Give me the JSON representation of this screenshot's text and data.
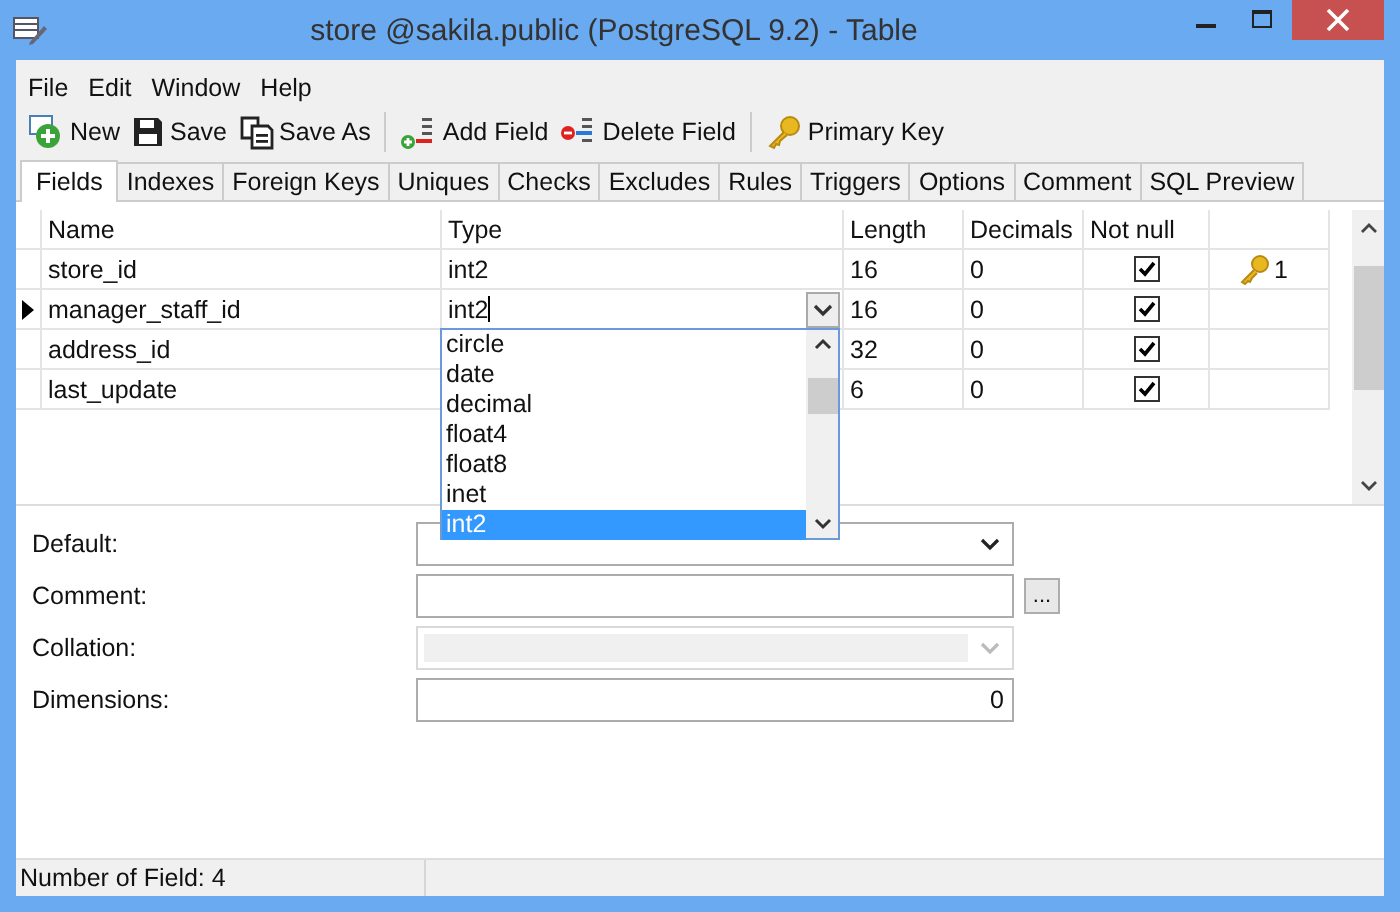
{
  "window": {
    "title": "store @sakila.public (PostgreSQL 9.2) - Table"
  },
  "menu": [
    "File",
    "Edit",
    "Window",
    "Help"
  ],
  "toolbar": [
    {
      "kind": "new",
      "label": "New"
    },
    {
      "kind": "save",
      "label": "Save"
    },
    {
      "kind": "saveas",
      "label": "Save As"
    },
    {
      "kind": "separator"
    },
    {
      "kind": "addfield",
      "label": "Add Field"
    },
    {
      "kind": "deletefield",
      "label": "Delete Field"
    },
    {
      "kind": "separator"
    },
    {
      "kind": "primarykey",
      "label": "Primary Key"
    }
  ],
  "tabs": [
    {
      "label": "Fields",
      "selected": true
    },
    {
      "label": "Indexes",
      "selected": false
    },
    {
      "label": "Foreign Keys",
      "selected": false
    },
    {
      "label": "Uniques",
      "selected": false
    },
    {
      "label": "Checks",
      "selected": false
    },
    {
      "label": "Excludes",
      "selected": false
    },
    {
      "label": "Rules",
      "selected": false
    },
    {
      "label": "Triggers",
      "selected": false
    },
    {
      "label": "Options",
      "selected": false
    },
    {
      "label": "Comment",
      "selected": false
    },
    {
      "label": "SQL Preview",
      "selected": false
    }
  ],
  "grid": {
    "columns": [
      "Name",
      "Type",
      "Length",
      "Decimals",
      "Not null"
    ],
    "rows": [
      {
        "name": "store_id",
        "type": "int2",
        "length": "16",
        "decimals": "0",
        "not_null": true,
        "primary_key": "1",
        "current": false
      },
      {
        "name": "manager_staff_id",
        "type": "int2",
        "length": "16",
        "decimals": "0",
        "not_null": true,
        "current": true
      },
      {
        "name": "address_id",
        "length": "32",
        "decimals": "0",
        "not_null": true,
        "current": false
      },
      {
        "name": "last_update",
        "length": "6",
        "decimals": "0",
        "not_null": true,
        "current": false
      }
    ]
  },
  "type_dropdown": {
    "items": [
      {
        "label": "circle",
        "selected": false
      },
      {
        "label": "date",
        "selected": false
      },
      {
        "label": "decimal",
        "selected": false
      },
      {
        "label": "float4",
        "selected": false
      },
      {
        "label": "float8",
        "selected": false
      },
      {
        "label": "inet",
        "selected": false
      },
      {
        "label": "int2",
        "selected": true
      }
    ]
  },
  "form": [
    {
      "label": "Default:",
      "kind": "combo",
      "disabled": false
    },
    {
      "label": "Comment:",
      "kind": "text",
      "button": "..."
    },
    {
      "label": "Collation:",
      "kind": "combo",
      "disabled": true
    },
    {
      "label": "Dimensions:",
      "kind": "number",
      "value": "0"
    }
  ],
  "status_bar": "Number of Field: 4"
}
